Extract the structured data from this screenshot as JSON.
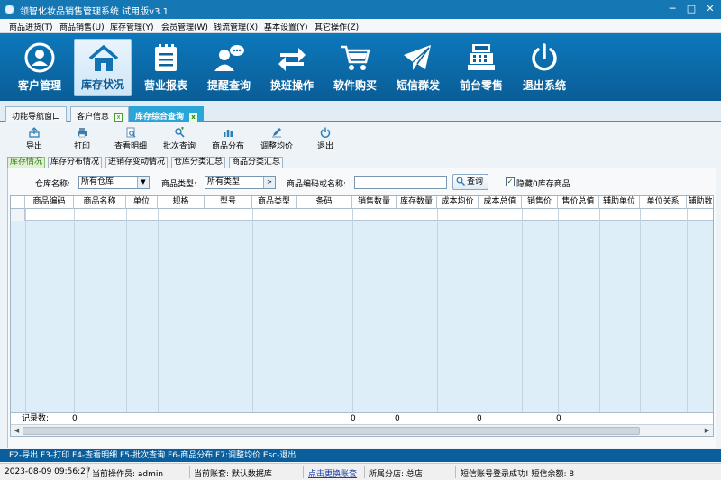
{
  "window": {
    "title": "领智化妆品销售管理系统 试用版v3.1",
    "controls": [
      "─",
      "□",
      "✕"
    ]
  },
  "menu": [
    "商品进货(T)",
    "商品销售(U)",
    "库存管理(Y)",
    "会员管理(W)",
    "钱流管理(X)",
    "基本设置(Y)",
    "其它操作(Z)"
  ],
  "big_toolbar": [
    {
      "label": "客户管理",
      "icon": "user-icon"
    },
    {
      "label": "库存状况",
      "icon": "house-icon",
      "active": true
    },
    {
      "label": "营业报表",
      "icon": "calendar-icon"
    },
    {
      "label": "提醒查询",
      "icon": "chat-user-icon"
    },
    {
      "label": "换班操作",
      "icon": "swap-arrows-icon"
    },
    {
      "label": "软件购买",
      "icon": "cart-icon"
    },
    {
      "label": "短信群发",
      "icon": "envelope-icon"
    },
    {
      "label": "前台零售",
      "icon": "cash-register-icon"
    },
    {
      "label": "退出系统",
      "icon": "power-icon"
    }
  ],
  "tabs": [
    {
      "label": "功能导航窗口",
      "closable": false
    },
    {
      "label": "客户信息",
      "closable": true
    },
    {
      "label": "库存综合查询",
      "closable": true,
      "active": true
    }
  ],
  "tab_close_glyph": "x",
  "small_toolbar": [
    {
      "label": "导出",
      "icon": "export-icon"
    },
    {
      "label": "打印",
      "icon": "print-icon"
    },
    {
      "label": "查看明细",
      "icon": "detail-icon"
    },
    {
      "label": "批次查询",
      "icon": "batch-search-icon"
    },
    {
      "label": "商品分布",
      "icon": "bar-chart-icon"
    },
    {
      "label": "调整均价",
      "icon": "pencil-icon"
    },
    {
      "label": "退出",
      "icon": "power-icon"
    }
  ],
  "sub_tabs": [
    {
      "label": "库存情况",
      "active": true
    },
    {
      "label": "库存分布情况"
    },
    {
      "label": "进销存变动情况"
    },
    {
      "label": "仓库分类汇总"
    },
    {
      "label": "商品分类汇总"
    }
  ],
  "filter": {
    "warehouse_label": "仓库名称:",
    "warehouse_value": "所有仓库",
    "type_label": "商品类型:",
    "type_value": "所有类型",
    "code_label": "商品编码或名称:",
    "code_value": "",
    "query_label": "查询",
    "hide_zero_label": "隐藏0库存商品",
    "hide_zero_checked": true,
    "check_glyph": "✓",
    "dropdown_glyph": "▼",
    "picker_glyph": ">"
  },
  "grid": {
    "columns": [
      "商品编码",
      "商品名称",
      "单位",
      "规格",
      "型号",
      "商品类型",
      "条码",
      "销售数量",
      "库存数量",
      "成本均价",
      "成本总值",
      "销售价",
      "售价总值",
      "辅助单位",
      "单位关系",
      "辅助数"
    ],
    "footer": {
      "label": "记录数:",
      "record_count": "0",
      "sales_qty": "0",
      "stock_qty": "0",
      "cost_total": "0",
      "sale_total": "0"
    },
    "scroll_left": "◀",
    "scroll_right": "▶"
  },
  "shortcuts": "F2-导出 F3-打印 F4-查看明细 F5-批次查询 F6-商品分布 F7:调整均价 Esc-退出",
  "status": {
    "datetime": "2023-08-09 09:56:27",
    "operator": "当前操作员: admin",
    "account": "当前账套: 默认数据库",
    "switch_link": "点击更换账套",
    "branch": "所属分店: 总店",
    "sms": "短信账号登录成功! 短信余额: 8"
  }
}
